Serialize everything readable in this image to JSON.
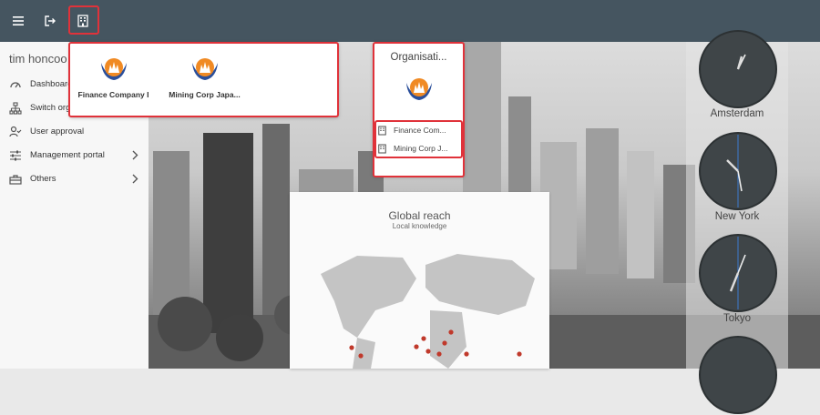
{
  "topbar": {
    "menu_icon": "menu-icon",
    "logout_icon": "logout-icon",
    "company_icon": "building-icon"
  },
  "sidebar": {
    "user_name": "tim honcoo",
    "items": [
      {
        "label": "Dashboard",
        "icon": "dashboard-icon"
      },
      {
        "label": "Switch org",
        "icon": "org-tree-icon"
      },
      {
        "label": "User approval",
        "icon": "user-check-icon"
      },
      {
        "label": "Management portal",
        "icon": "sliders-icon",
        "expandable": true
      },
      {
        "label": "Others",
        "icon": "toolbox-icon",
        "expandable": true
      }
    ]
  },
  "company_menu": {
    "items": [
      {
        "name": "Finance Company I"
      },
      {
        "name": "Mining Corp Japa..."
      }
    ]
  },
  "org_menu": {
    "title": "Organisati...",
    "items": [
      {
        "name": "Finance Com..."
      },
      {
        "name": "Mining Corp J..."
      }
    ]
  },
  "card": {
    "title": "Global reach",
    "subtitle": "Local knowledge"
  },
  "clocks": {
    "cities": [
      "Amsterdam",
      "New York",
      "Tokyo"
    ]
  },
  "colors": {
    "topbar": "#455560",
    "highlight": "#e0323a",
    "logo_orange": "#f08a24",
    "logo_blue": "#2a4f9b",
    "map_dot": "#c0392b"
  }
}
